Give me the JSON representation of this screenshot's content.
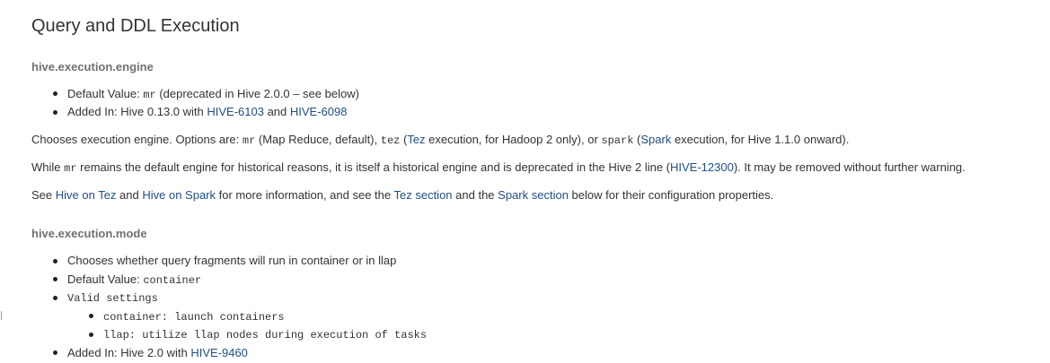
{
  "section_title": "Query and DDL Execution",
  "engine": {
    "heading": "hive.execution.engine",
    "bullets": {
      "default_label": "Default Value: ",
      "default_code": "mr",
      "default_suffix": " (deprecated in Hive 2.0.0 – see below)",
      "added_prefix": "Added In: Hive 0.13.0 with ",
      "added_link1": "HIVE-6103",
      "added_and": " and ",
      "added_link2": "HIVE-6098"
    },
    "para1": {
      "t1": "Chooses execution engine. Options are: ",
      "c1": "mr",
      "t2": " (Map Reduce, default), ",
      "c2": "tez",
      "t3": " (",
      "l1": "Tez",
      "t4": " execution, for Hadoop 2 only), or ",
      "c3": "spark",
      "t5": " (",
      "l2": "Spark",
      "t6": " execution, for Hive 1.1.0 onward)."
    },
    "para2": {
      "t1": "While ",
      "c1": "mr",
      "t2": " remains the default engine for historical reasons, it is itself a historical engine and is deprecated in the Hive 2 line (",
      "l1": "HIVE-12300",
      "t3": "). It may be removed without further warning."
    },
    "para3": {
      "t1": "See ",
      "l1": "Hive on Tez",
      "t2": " and ",
      "l2": "Hive on Spark",
      "t3": " for more information, and see the ",
      "l3": "Tez section",
      "t4": " and the ",
      "l4": "Spark section",
      "t5": " below for their configuration properties."
    }
  },
  "mode": {
    "heading": "hive.execution.mode",
    "bullet1": "Chooses whether query fragments will run in container or in llap",
    "default_label": "Default Value: ",
    "default_code": "container",
    "valid_settings": "Valid settings",
    "settings": [
      "container: launch containers",
      "llap: utilize llap nodes during execution of tasks"
    ],
    "added_prefix": "Added In: Hive 2.0 with ",
    "added_link": "HIVE-9460"
  },
  "colors": {
    "link": "#205081",
    "heading_gray": "#707070",
    "text": "#333333"
  }
}
